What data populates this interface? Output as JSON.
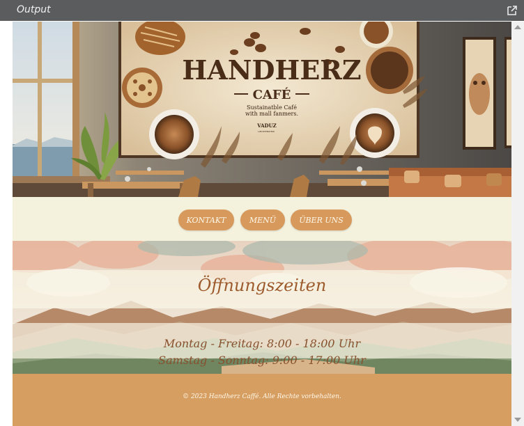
{
  "panel": {
    "title": "Output",
    "popout_icon": "external-link-icon"
  },
  "hero": {
    "brand_name": "HANDHERZ",
    "brand_sub": "CAFÉ",
    "tagline_line1": "Sustainatble Café",
    "tagline_line2": "with mall fanmers.",
    "location": "VADUZ",
    "location_sub": "LIECHTENSTEIN"
  },
  "nav": {
    "items": [
      {
        "label": "KONTAKT"
      },
      {
        "label": "MENÜ"
      },
      {
        "label": "ÜBER UNS"
      }
    ]
  },
  "hours": {
    "title": "Öffnungszeiten",
    "weekday": "Montag - Freitag: 8:00 - 18:00 Uhr",
    "weekend": "Samstag - Sonntag: 9:00 - 17:00 Uhr"
  },
  "footer": {
    "text": "© 2023 Handherz Caffé. Alle Rechte vorbehalten."
  },
  "colors": {
    "nav_bg": "#f4f1dd",
    "button": "#d79a5c",
    "footer": "#d79e61",
    "heading": "#9d5a2c"
  }
}
